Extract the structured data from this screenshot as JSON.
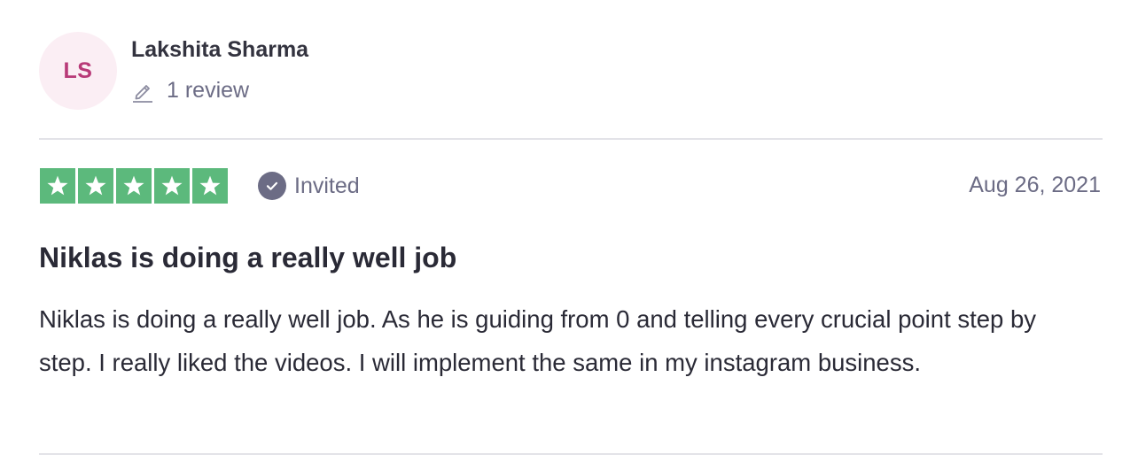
{
  "consumer": {
    "initials": "LS",
    "name": "Lakshita Sharma",
    "review_count": "1 review",
    "avatar_bg": "#fbeef4",
    "avatar_text_color": "#b83a78",
    "count_icon": "pencil-icon"
  },
  "review": {
    "rating": 5,
    "rating_max": 5,
    "star_color": "#5cb97c",
    "star_icon": "star-icon",
    "invited_icon": "check-circle-icon",
    "invited_label": "Invited",
    "date": "Aug 26, 2021",
    "title": "Niklas is doing a really well job",
    "body": "Niklas is doing a really well job. As he is guiding from 0 and telling every crucial point step by step. I really liked the videos. I will implement the same in my instagram business."
  }
}
